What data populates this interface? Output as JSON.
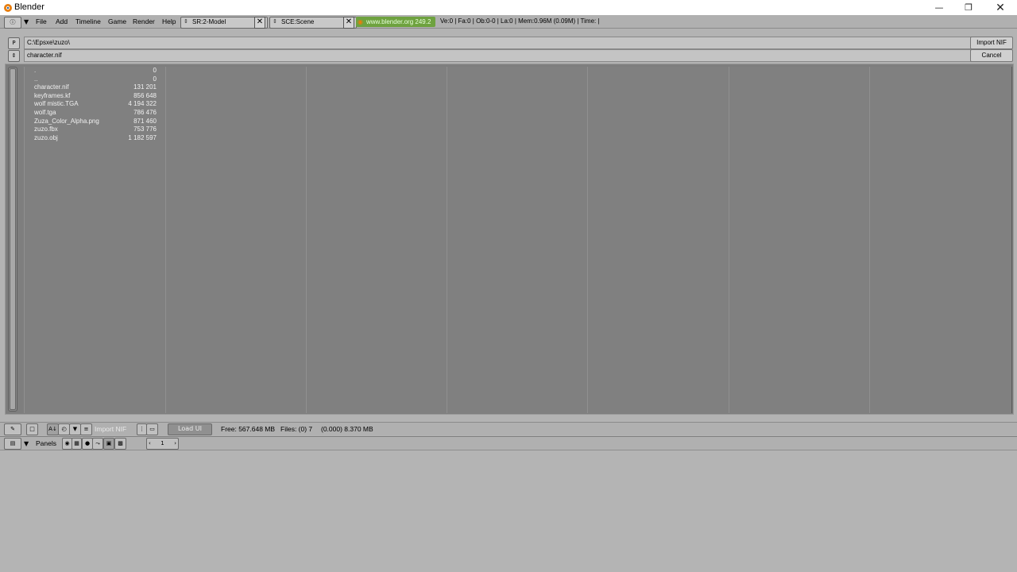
{
  "window": {
    "title": "Blender",
    "controls": [
      "minimize-icon",
      "restore-icon",
      "close-icon"
    ]
  },
  "header": {
    "menus": [
      "File",
      "Add",
      "Timeline",
      "Game",
      "Render",
      "Help"
    ],
    "screen_field": "SR:2-Model",
    "scene_field": "SCE:Scene",
    "url": "www.blender.org 249.2",
    "stats": "Ve:0 | Fa:0 | Ob:0-0 | La:0  | Mem:0.96M (0.09M)  | Time: |"
  },
  "filebrowser": {
    "parent_button": "P",
    "path": "C:\\Epsxe\\zuzo\\",
    "filename": "character.nif",
    "import_button": "Import NIF",
    "cancel_button": "Cancel",
    "files": [
      {
        "name": ".",
        "size": "0"
      },
      {
        "name": "..",
        "size": "0"
      },
      {
        "name": "character.nif",
        "size": "131 201"
      },
      {
        "name": "keyframes.kf",
        "size": "856 648"
      },
      {
        "name": "wolf mistic.TGA",
        "size": "4 194 322"
      },
      {
        "name": "wolf.tga",
        "size": "786 476"
      },
      {
        "name": "Zuza_Color_Alpha.png",
        "size": "871 460"
      },
      {
        "name": "zuzo.fbx",
        "size": "753 776"
      },
      {
        "name": "zuzo.obj",
        "size": "1 182 597"
      }
    ],
    "footer": {
      "mode_label": "Import NIF",
      "load_ui": "Load UI",
      "free": "Free: 567.648 MB",
      "files": "Files: (0) 7",
      "selected": "(0.000) 8.370 MB"
    }
  },
  "buttons_window": {
    "panels_label": "Panels",
    "page_number": "1"
  },
  "colors": {
    "background": "#b3b3b3",
    "file_area": "#808080",
    "url_highlight": "#6ea23f"
  }
}
